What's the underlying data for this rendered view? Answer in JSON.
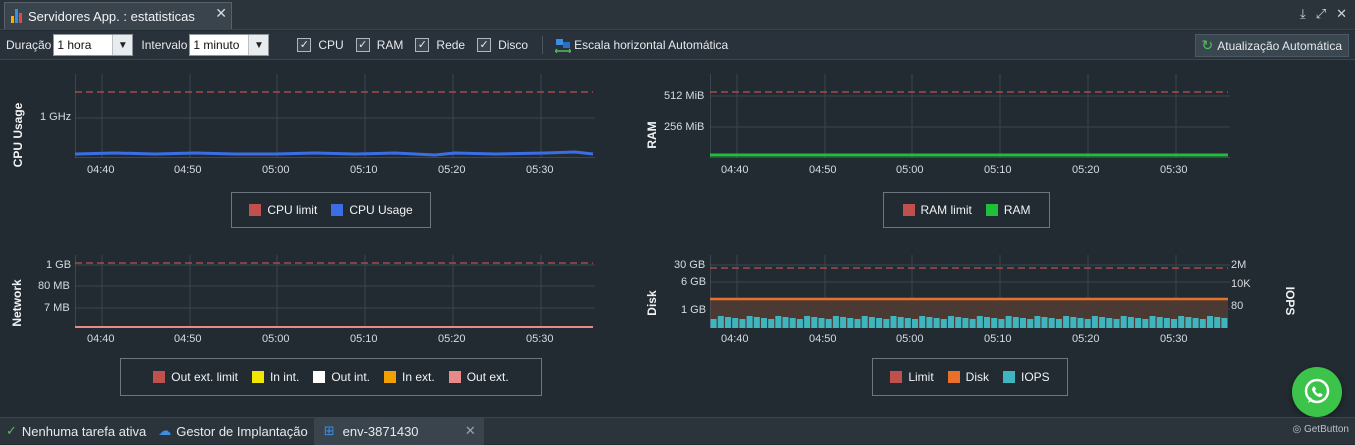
{
  "tab": {
    "title": "Servidores App. : estatisticas",
    "close": "✕"
  },
  "toolbar": {
    "duration_label": "Duração",
    "duration_value": "1 hora",
    "interval_label": "Intervalo",
    "interval_value": "1 minuto",
    "checks": [
      {
        "label": "CPU",
        "checked": true
      },
      {
        "label": "RAM",
        "checked": true
      },
      {
        "label": "Rede",
        "checked": true
      },
      {
        "label": "Disco",
        "checked": true
      }
    ],
    "scale_label": "Escala horizontal Automática",
    "auto_refresh_label": "Atualização Automática"
  },
  "colors": {
    "limit": "#c0504d",
    "cpu": "#3b6ee6",
    "ram": "#1fbf3b",
    "out_ext_limit": "#c0504d",
    "in_int": "#f2e600",
    "out_int": "#ffffff",
    "in_ext": "#f0a000",
    "out_ext": "#e98a8a",
    "disk": "#e8702a",
    "iops": "#3fb6bf",
    "background": "#222b32"
  },
  "charts": {
    "x_ticks": [
      "04:40",
      "04:50",
      "05:00",
      "05:10",
      "05:20",
      "05:30"
    ],
    "cpu": {
      "ylabel": "CPU Usage",
      "y_ticks": [
        "1 GHz"
      ],
      "legend": [
        "CPU limit",
        "CPU Usage"
      ]
    },
    "ram": {
      "ylabel": "RAM",
      "y_ticks": [
        "512 MiB",
        "256 MiB"
      ],
      "legend": [
        "RAM limit",
        "RAM"
      ]
    },
    "network": {
      "ylabel": "Network",
      "y_ticks": [
        "1 GB",
        "80 MB",
        "7 MB"
      ],
      "legend": [
        "Out ext. limit",
        "In int.",
        "Out int.",
        "In ext.",
        "Out ext."
      ]
    },
    "disk": {
      "ylabel": "Disk",
      "ylabel_right": "IOPS",
      "y_ticks": [
        "30 GB",
        "6 GB",
        "1 GB"
      ],
      "y_ticks_right": [
        "2M",
        "10K",
        "80"
      ],
      "legend": [
        "Limit",
        "Disk",
        "IOPS"
      ]
    }
  },
  "bottombar": {
    "tasks": "Nenhuma tarefa ativa",
    "deploy_manager": "Gestor de Implantação",
    "env": "env-3871430",
    "close": "✕",
    "getbutton": "GetButton"
  }
}
